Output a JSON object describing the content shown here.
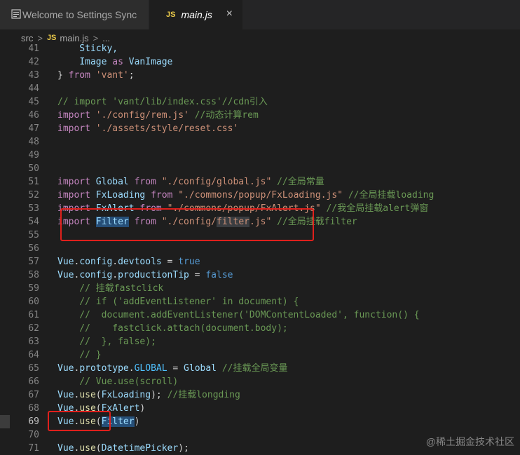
{
  "tabs": [
    {
      "label": "Welcome to Settings Sync",
      "active": false
    },
    {
      "label": "main.js",
      "icon": "JS",
      "active": true,
      "close": "×"
    }
  ],
  "breadcrumb": {
    "folder": "src",
    "sep": ">",
    "icon": "JS",
    "file": "main.js",
    "more": "..."
  },
  "watermark": "@稀土掘金技术社区",
  "lines": [
    {
      "n": "41",
      "t": "    Sticky,"
    },
    {
      "n": "42",
      "t": "    Image as VanImage"
    },
    {
      "n": "43",
      "t": "} from 'vant';"
    },
    {
      "n": "44",
      "t": ""
    },
    {
      "n": "45",
      "t": "// import 'vant/lib/index.css'//cdn引入"
    },
    {
      "n": "46",
      "t": "import './config/rem.js' //动态计算rem"
    },
    {
      "n": "47",
      "t": "import './assets/style/reset.css'"
    },
    {
      "n": "48",
      "t": ""
    },
    {
      "n": "49",
      "t": ""
    },
    {
      "n": "50",
      "t": ""
    },
    {
      "n": "51",
      "t": "import Global from \"./config/global.js\" //全局常量"
    },
    {
      "n": "52",
      "t": "import FxLoading from \"./commons/popup/FxLoading.js\" //全局挂载loading"
    },
    {
      "n": "53",
      "t": "import FxAlert from \"./commons/popup/FxAlert.js\" //我全局挂载alert弹窗"
    },
    {
      "n": "54",
      "t": "import Filter from \"./config/filter.js\" //全局挂载filter"
    },
    {
      "n": "55",
      "t": ""
    },
    {
      "n": "56",
      "t": ""
    },
    {
      "n": "57",
      "t": "Vue.config.devtools = true"
    },
    {
      "n": "58",
      "t": "Vue.config.productionTip = false"
    },
    {
      "n": "59",
      "t": "    // 挂载fastclick"
    },
    {
      "n": "60",
      "t": "    // if ('addEventListener' in document) {"
    },
    {
      "n": "61",
      "t": "    //  document.addEventListener('DOMContentLoaded', function() {"
    },
    {
      "n": "62",
      "t": "    //    fastclick.attach(document.body);"
    },
    {
      "n": "63",
      "t": "    //  }, false);"
    },
    {
      "n": "64",
      "t": "    // }"
    },
    {
      "n": "65",
      "t": "Vue.prototype.GLOBAL = Global //挂载全局变量"
    },
    {
      "n": "66",
      "t": "    // Vue.use(scroll)"
    },
    {
      "n": "67",
      "t": "Vue.use(FxLoading); //挂载longding"
    },
    {
      "n": "68",
      "t": "Vue.use(FxAlert)"
    },
    {
      "n": "69",
      "t": "Vue.use(Filter)"
    },
    {
      "n": "70",
      "t": ""
    },
    {
      "n": "71",
      "t": "Vue.use(DatetimePicker);"
    }
  ]
}
